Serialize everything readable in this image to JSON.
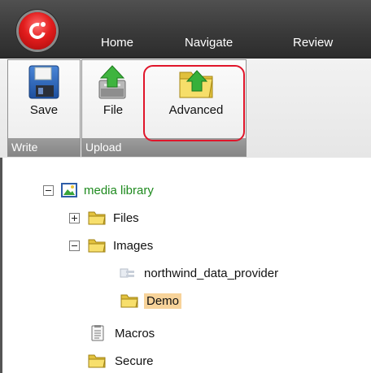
{
  "menu": {
    "items": [
      {
        "label": "Home"
      },
      {
        "label": "Navigate"
      },
      {
        "label": "Review"
      }
    ]
  },
  "ribbon": {
    "groups": [
      {
        "label": "Write",
        "buttons": [
          {
            "label": "Save",
            "icon": "floppy-disk-icon"
          }
        ]
      },
      {
        "label": "Upload",
        "buttons": [
          {
            "label": "File",
            "icon": "upload-file-icon"
          },
          {
            "label": "Advanced",
            "icon": "upload-folder-icon"
          }
        ]
      }
    ],
    "highlight_color": "#e0152a"
  },
  "tree": {
    "root": {
      "label": "media library",
      "icon": "media-library-icon",
      "expanded": true
    },
    "items": [
      {
        "label": "Files",
        "icon": "folder-icon",
        "expanded": false
      },
      {
        "label": "Images",
        "icon": "folder-icon",
        "expanded": true
      },
      {
        "label": "northwind_data_provider",
        "icon": "image-file-icon"
      },
      {
        "label": "Demo",
        "icon": "folder-icon",
        "selected": true
      },
      {
        "label": "Macros",
        "icon": "document-icon"
      },
      {
        "label": "Secure",
        "icon": "folder-icon"
      }
    ]
  },
  "colors": {
    "titlebar": "#3a3a3a",
    "group_label_bg": "#8f8f8f",
    "selected_bg": "#f7d39a",
    "root_label": "#1e8a1e"
  }
}
